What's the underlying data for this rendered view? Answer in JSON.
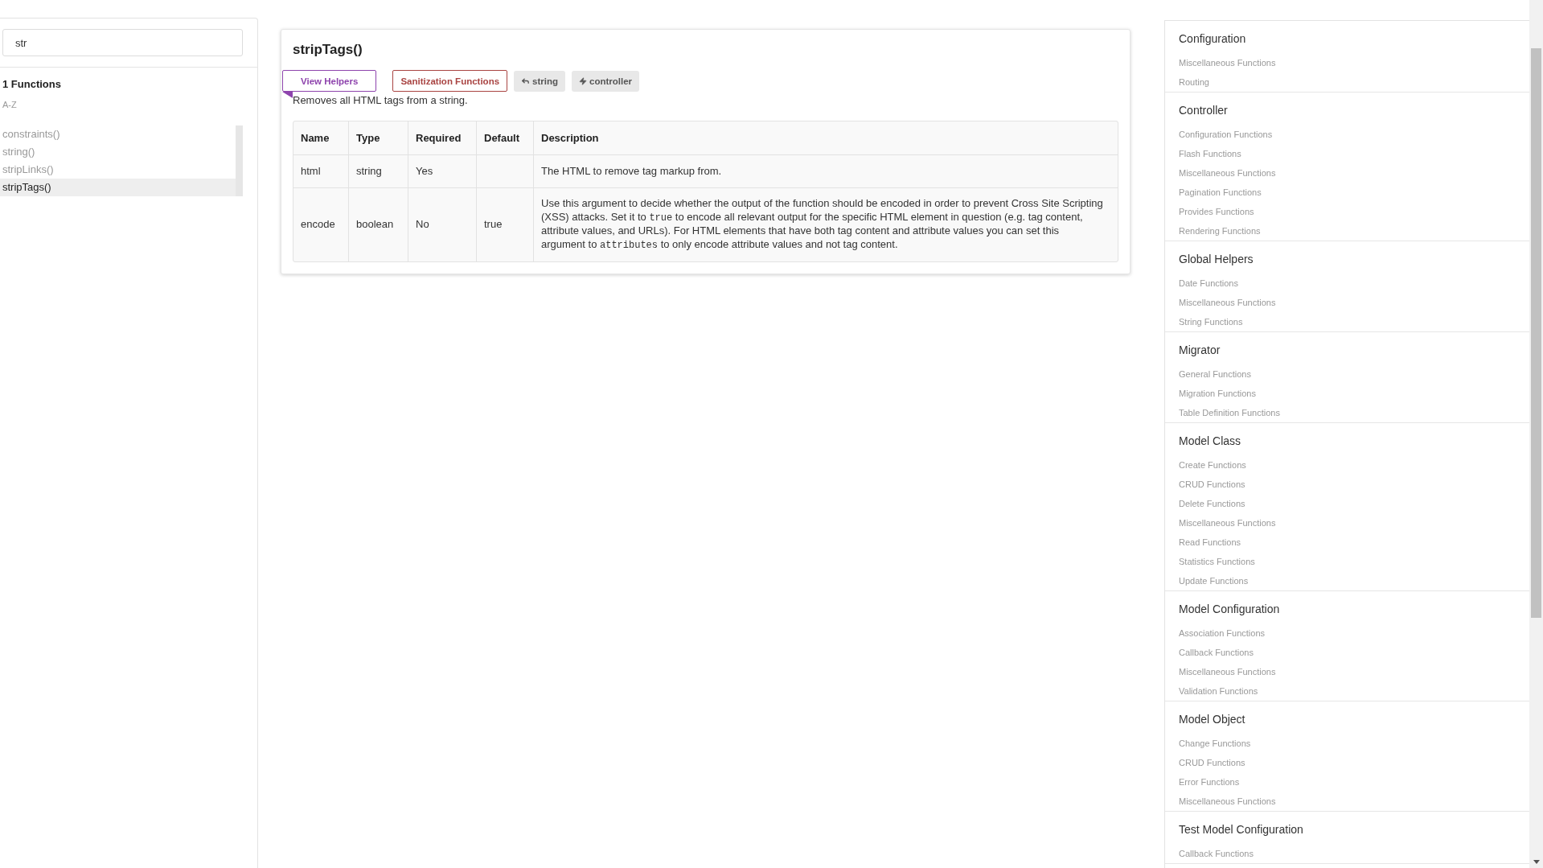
{
  "search": {
    "value": "str"
  },
  "results": {
    "count_label": "1 Functions",
    "sort_label": "A-Z",
    "items": [
      {
        "label": "constraints()",
        "selected": false
      },
      {
        "label": "string()",
        "selected": false
      },
      {
        "label": "stripLinks()",
        "selected": false
      },
      {
        "label": "stripTags()",
        "selected": true
      }
    ]
  },
  "function": {
    "title": "stripTags()",
    "tags": [
      {
        "kind": "category",
        "label": "View Helpers",
        "color": "#8e44ad",
        "ribbon": true
      },
      {
        "kind": "category",
        "label": "Sanitization Functions",
        "color": "#a94442",
        "ribbon": false
      },
      {
        "kind": "returns",
        "label": "string"
      },
      {
        "kind": "scope",
        "label": "controller"
      }
    ],
    "summary": "Removes all HTML tags from a string.",
    "table": {
      "columns": [
        "Name",
        "Type",
        "Required",
        "Default",
        "Description"
      ],
      "rows": [
        {
          "cells": [
            "html",
            "string",
            "Yes",
            ""
          ],
          "description": [
            {
              "kind": "text",
              "text": "The HTML to remove tag markup from."
            }
          ]
        },
        {
          "cells": [
            "encode",
            "boolean",
            "No",
            "true"
          ],
          "description": [
            {
              "kind": "text",
              "text": "Use this argument to decide whether the output of the function should be encoded in order to prevent Cross Site Scripting (XSS) attacks. Set it to "
            },
            {
              "kind": "code",
              "text": "true"
            },
            {
              "kind": "text",
              "text": " to encode all relevant output for the specific HTML element in question (e.g. tag content, attribute values, and URLs). For HTML elements that have both tag content and attribute values you can set this argument to "
            },
            {
              "kind": "code",
              "text": "attributes"
            },
            {
              "kind": "text",
              "text": " to only encode attribute values and not tag content."
            }
          ]
        }
      ]
    }
  },
  "categories": [
    {
      "title": "Configuration",
      "items": [
        "Miscellaneous Functions",
        "Routing"
      ]
    },
    {
      "title": "Controller",
      "items": [
        "Configuration Functions",
        "Flash Functions",
        "Miscellaneous Functions",
        "Pagination Functions",
        "Provides Functions",
        "Rendering Functions"
      ]
    },
    {
      "title": "Global Helpers",
      "items": [
        "Date Functions",
        "Miscellaneous Functions",
        "String Functions"
      ]
    },
    {
      "title": "Migrator",
      "items": [
        "General Functions",
        "Migration Functions",
        "Table Definition Functions"
      ]
    },
    {
      "title": "Model Class",
      "items": [
        "Create Functions",
        "CRUD Functions",
        "Delete Functions",
        "Miscellaneous Functions",
        "Read Functions",
        "Statistics Functions",
        "Update Functions"
      ]
    },
    {
      "title": "Model Configuration",
      "items": [
        "Association Functions",
        "Callback Functions",
        "Miscellaneous Functions",
        "Validation Functions"
      ]
    },
    {
      "title": "Model Object",
      "items": [
        "Change Functions",
        "CRUD Functions",
        "Error Functions",
        "Miscellaneous Functions"
      ]
    },
    {
      "title": "Test Model Configuration",
      "items": [
        "Callback Functions"
      ]
    }
  ]
}
